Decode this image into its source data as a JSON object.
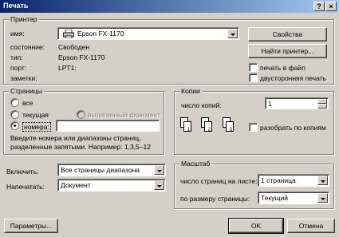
{
  "window": {
    "title": "Печать"
  },
  "titlebar_buttons": {
    "help": "?",
    "close": "×"
  },
  "printer": {
    "group_label": "Принтер",
    "name_label": "имя:",
    "name_value": "Epson FX-1170",
    "status_label": "состояние:",
    "status_value": "Свободен",
    "type_label": "тип:",
    "type_value": "Epson FX-1170",
    "port_label": "порт:",
    "port_value": "LPT1:",
    "notes_label": "заметки:",
    "properties_button": "Свойства",
    "find_button": "Найти принтер...",
    "print_to_file": "печать в файл",
    "duplex": "двусторонняя печать"
  },
  "pages": {
    "group_label": "Страницы",
    "all": "все",
    "current": "текущая",
    "selection": "выделенный фрагмент",
    "numbers": "номера:",
    "numbers_value": "",
    "hint": "Введите номера или диапазоны страниц, разделенные запятыми. Например: 1,3,5–12"
  },
  "copies": {
    "group_label": "Копии",
    "count_label": "число копий:",
    "count_value": "1",
    "collate": "разобрать по копиям",
    "page_numbers": [
      "1",
      "2",
      "3"
    ]
  },
  "include": {
    "label": "Включить:",
    "value": "Все страницы диапазона"
  },
  "print_what": {
    "label": "Напечатать:",
    "value": "Документ"
  },
  "scale": {
    "group_label": "Масштаб",
    "pages_per_sheet_label": "число страниц на листе:",
    "pages_per_sheet_value": "1 страница",
    "fit_label": "по размеру страницы:",
    "fit_value": "Текущий"
  },
  "footer": {
    "options_button": "Параметры...",
    "ok_button": "OK",
    "cancel_button": "Отмена"
  }
}
